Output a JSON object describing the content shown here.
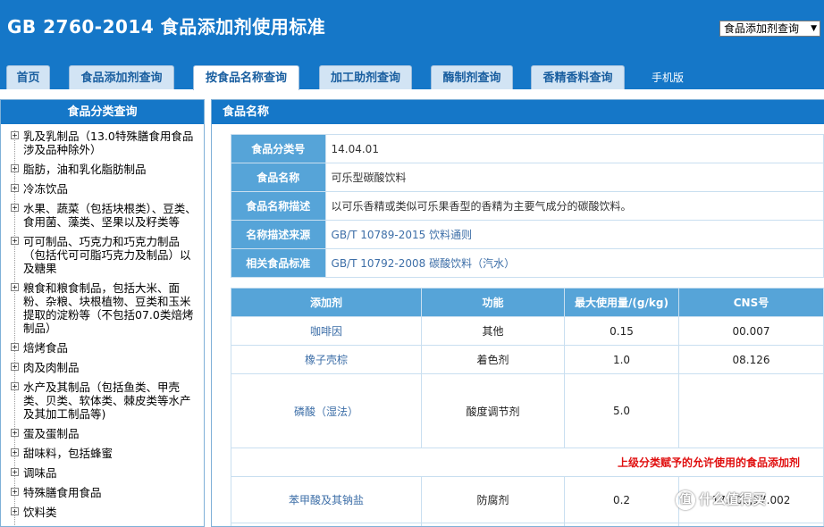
{
  "app": {
    "title": "GB 2760-2014 食品添加剂使用标准",
    "mode_select": "食品添加剂查询"
  },
  "tabs": [
    {
      "label": "首页"
    },
    {
      "label": "食品添加剂查询"
    },
    {
      "label": "按食品名称查询"
    },
    {
      "label": "加工助剂查询"
    },
    {
      "label": "酶制剂查询"
    },
    {
      "label": "香精香料查询"
    },
    {
      "label": "手机版"
    }
  ],
  "sidebar": {
    "title": "食品分类查询",
    "items": [
      {
        "label": "乳及乳制品（13.0特殊膳食用食品涉及品种除外）"
      },
      {
        "label": "脂肪，油和乳化脂肪制品"
      },
      {
        "label": "冷冻饮品"
      },
      {
        "label": "水果、蔬菜（包括块根类）、豆类、食用菌、藻类、坚果以及籽类等"
      },
      {
        "label": "可可制品、巧克力和巧克力制品（包括代可可脂巧克力及制品）以及糖果"
      },
      {
        "label": "粮食和粮食制品，包括大米、面粉、杂粮、块根植物、豆类和玉米提取的淀粉等（不包括07.0类焙烤制品）"
      },
      {
        "label": "焙烤食品"
      },
      {
        "label": "肉及肉制品"
      },
      {
        "label": "水产及其制品（包括鱼类、甲壳类、贝类、软体类、棘皮类等水产及其加工制品等)"
      },
      {
        "label": "蛋及蛋制品"
      },
      {
        "label": "甜味料，包括蜂蜜"
      },
      {
        "label": "调味品"
      },
      {
        "label": "特殊膳食用食品"
      },
      {
        "label": "饮料类"
      }
    ]
  },
  "main": {
    "title": "食品名称",
    "info": [
      {
        "label": "食品分类号",
        "value": "14.04.01"
      },
      {
        "label": "食品名称",
        "value": "可乐型碳酸饮料"
      },
      {
        "label": "食品名称描述",
        "value": "以可乐香精或类似可乐果香型的香精为主要气成分的碳酸饮料。"
      },
      {
        "label": "名称描述来源",
        "value": "GB/T 10789-2015 饮料通则"
      },
      {
        "label": "相关食品标准",
        "value": "GB/T 10792-2008 碳酸饮料（汽水）"
      }
    ],
    "additives_headers": [
      "添加剂",
      "功能",
      "最大使用量/(g/kg)",
      "CNS号"
    ],
    "additives": [
      {
        "name": "咖啡因",
        "function": "其他",
        "max": "0.15",
        "cns": "00.007"
      },
      {
        "name": "橡子壳棕",
        "function": "着色剂",
        "max": "1.0",
        "cns": "08.126"
      },
      {
        "name": "磷酸（湿法）",
        "function": "酸度调节剂",
        "max": "5.0",
        "cns": ""
      }
    ],
    "parent_note": "上级分类赋予的允许使用的食品添加剂",
    "additives_parent": [
      {
        "name": "苯甲酸及其钠盐",
        "function": "防腐剂",
        "max": "0.2",
        "cns": "17.001,17.002"
      }
    ]
  },
  "watermark": {
    "text": "什么值得买",
    "icon": "值"
  }
}
